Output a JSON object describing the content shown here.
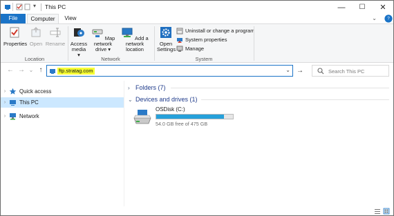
{
  "window": {
    "title": "This PC",
    "controls": {
      "minimize": "—",
      "maximize": "☐",
      "close": "✕"
    }
  },
  "ribbon_tabs": {
    "file": "File",
    "computer": "Computer",
    "view": "View",
    "collapse": "⌄",
    "help": "?"
  },
  "ribbon": {
    "location": {
      "label": "Location",
      "properties": "Properties",
      "open": "Open",
      "rename": "Rename"
    },
    "network": {
      "label": "Network",
      "access_media_1": "Access",
      "access_media_2": "media ▾",
      "map_drive_1": "Map network",
      "map_drive_2": "drive ▾",
      "add_location_1": "Add a network",
      "add_location_2": "location"
    },
    "system": {
      "label": "System",
      "open_settings_1": "Open",
      "open_settings_2": "Settings",
      "uninstall": "Uninstall or change a program",
      "properties": "System properties",
      "manage": "Manage"
    }
  },
  "navigation": {
    "back": "←",
    "forward": "→",
    "recent": "⌄",
    "up": "↑",
    "address_value": "ftp.stratag.com",
    "address_dropdown": "⌄",
    "go": "→",
    "search_placeholder": "Search This PC"
  },
  "nav_pane": {
    "items": [
      {
        "label": "Quick access",
        "icon": "star-icon"
      },
      {
        "label": "This PC",
        "icon": "computer-icon",
        "selected": true
      },
      {
        "label": "Network",
        "icon": "network-icon"
      }
    ]
  },
  "content": {
    "folders_header": "Folders (7)",
    "devices_header": "Devices and drives (1)",
    "drive": {
      "name": "OSDisk (C:)",
      "free_text": "54.0 GB free of 475 GB",
      "used_fraction": 0.886
    }
  },
  "colors": {
    "accent": "#1a73c7",
    "selected_bg": "#cce8ff",
    "drive_bar": "#26a0da",
    "address_highlight": "#f6ff33"
  }
}
